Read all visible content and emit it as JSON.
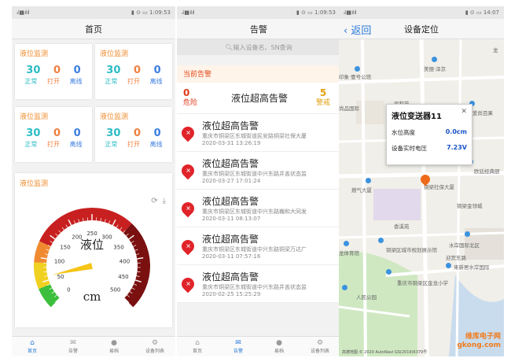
{
  "statusbar": {
    "signal": "ₐᵢˡ ▮▮ ıl ıl",
    "time1": "▮ ⊙ ▭ 1:09:53",
    "time2": "▮ ⊙ ▭ 1:09:53",
    "time3": "▮ ⊙ ▭ 14:07"
  },
  "home": {
    "title": "首页",
    "cards": [
      {
        "title": "液位监测",
        "normal": "30",
        "open": "0",
        "offline": "0"
      },
      {
        "title": "液位监测",
        "normal": "30",
        "open": "0",
        "offline": "0"
      },
      {
        "title": "液位监测",
        "normal": "30",
        "open": "0",
        "offline": "0"
      },
      {
        "title": "液位监测",
        "normal": "30",
        "open": "0",
        "offline": "0"
      }
    ],
    "labels": {
      "normal": "正常",
      "open": "打开",
      "offline": "离线"
    },
    "gauge": {
      "title": "液位监测",
      "name": "液位",
      "unit": "cm",
      "ticks": [
        "0",
        "50",
        "100",
        "150",
        "200",
        "250",
        "300",
        "350",
        "400",
        "450",
        "500"
      ],
      "value": 60,
      "min": 0,
      "max": 500,
      "colors": {
        "green": "#3cbf3c",
        "yellow": "#f0d020",
        "orange": "#f08a30",
        "red": "#c82020",
        "darkred": "#7a1010",
        "needle": "#f5c518"
      }
    }
  },
  "tabs": [
    {
      "label": "首页",
      "icon": "home-icon"
    },
    {
      "label": "告警",
      "icon": "mail-icon"
    },
    {
      "label": "易档",
      "icon": "user-icon"
    },
    {
      "label": "设备列表",
      "icon": "gear-icon"
    }
  ],
  "alarm": {
    "title": "告警",
    "search_placeholder": "输入设备名、SN查询",
    "section": "当前告警",
    "danger_count": "0",
    "danger_label": "危险",
    "summary_title": "液位超高告警",
    "warn_count": "5",
    "warn_label": "警戒",
    "items": [
      {
        "title": "液位超高告警",
        "addr": "重庆市铜梁区东城街道民安路铜梁社保大厦",
        "time": "2020-03-31 13:26:19"
      },
      {
        "title": "液位超高告警",
        "addr": "重庆市铜梁区东城街道中兴东路井盖状态监",
        "time": "2020-03-27 17:01:24"
      },
      {
        "title": "液位超高告警",
        "addr": "重庆市铜梁区东城街道中兴东路巍和大同发",
        "time": "2020-03-11 08:13:07"
      },
      {
        "title": "液位超高告警",
        "addr": "重庆市铜梁区东城街道中兴东路铜梁万达广",
        "time": "2020-03-11 07:57:16"
      },
      {
        "title": "液位超高告警",
        "addr": "重庆市铜梁区东城街道中兴东路井盖状态监",
        "time": "2020-02-25 15:25:29"
      }
    ]
  },
  "location": {
    "back": "返回",
    "title": "设备定位",
    "popup": {
      "title": "液位变送器11",
      "row1_label": "水位高度",
      "row1_value": "0.0cm",
      "row2_label": "设备实时电压",
      "row2_value": "7.23V"
    },
    "places": [
      "印象·壹号公馆",
      "美丽·泽京",
      "尚品国际",
      "家和苑",
      "爱尚百果",
      "欧廷经典厨",
      "燃气大厦",
      "铜梁社保大厦",
      "铜梁金领城",
      "香溪苑",
      "水岸国际北区",
      "铜梁区城市规划展示馆",
      "迎宾东路",
      "来新居水岸国际",
      "龙体育馆",
      "重庆市铜梁区金龙小学",
      "人民公园",
      "龙"
    ],
    "map_copyright": "高德地图 © 2020 AutoNavi GS(2019)6379号",
    "watermark1": "维库电子网",
    "watermark2": "gkong.com"
  }
}
